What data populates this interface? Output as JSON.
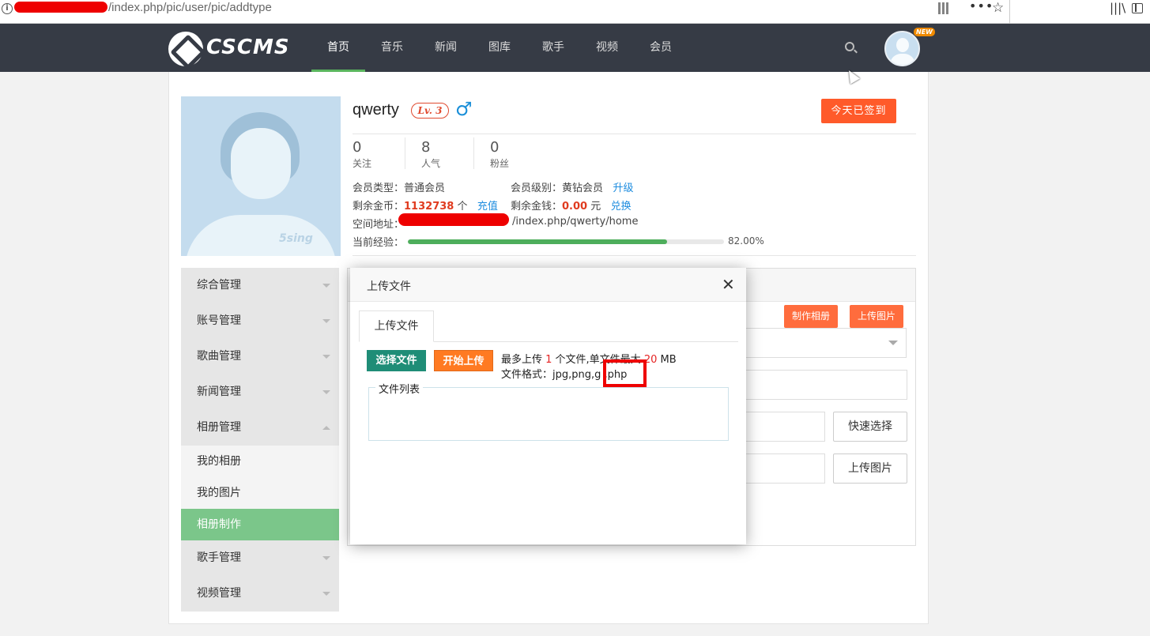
{
  "browser": {
    "url": "/index.php/pic/user/pic/addtype"
  },
  "nav": {
    "logo_text": "CSCMS",
    "items": [
      "首页",
      "音乐",
      "新闻",
      "图库",
      "歌手",
      "视频",
      "会员"
    ],
    "new_badge": "NEW"
  },
  "profile": {
    "username": "qwerty",
    "level": "Lv. 3",
    "gender_icon": "male-symbol",
    "signin_button": "今天已签到",
    "stats": [
      {
        "value": "0",
        "label": "关注"
      },
      {
        "value": "8",
        "label": "人气"
      },
      {
        "value": "0",
        "label": "粉丝"
      }
    ],
    "member_type_label": "会员类型：",
    "member_type": "普通会员",
    "member_level_label": "会员级别：",
    "member_level": "黄钻会员",
    "upgrade_link": "升级",
    "coins_label": "剩余金币：",
    "coins": "1132738",
    "coins_unit": "个",
    "recharge_link": "充值",
    "money_label": "剩余金钱：",
    "money": "0.00",
    "money_unit": "元",
    "exchange_link": "兑换",
    "space_label": "空间地址：",
    "space_url_tail": "/index.php/qwerty/home",
    "exp_label": "当前经验：",
    "exp_percent_text": "82.00%",
    "exp_fraction": 0.82,
    "avatar_brand": "5sing"
  },
  "sidebar": {
    "items": [
      "综合管理",
      "账号管理",
      "歌曲管理",
      "新闻管理",
      "相册管理"
    ],
    "sub_items": [
      "我的相册",
      "我的图片",
      "相册制作"
    ],
    "active_sub": "相册制作",
    "bottom_items": [
      "歌手管理",
      "视频管理"
    ]
  },
  "content": {
    "make_album_button": "制作相册",
    "upload_image_button": "上传图片",
    "quick_select_button": "快速选择",
    "upload_image_button_2": "上传图片"
  },
  "modal": {
    "title": "上传文件",
    "tab": "上传文件",
    "choose_button": "选择文件",
    "start_button": "开始上传",
    "limit_prefix": "最多上传 ",
    "limit_count": "1",
    "limit_middle": " 个文件,单文件最大 ",
    "limit_size": "20",
    "limit_suffix": " MB",
    "formats": "文件格式：jpg,png,g ,php",
    "filelist_legend": "文件列表"
  },
  "colors": {
    "nav_bg": "#363b45",
    "accent_orange": "#ff5a2a",
    "accent_green": "#7bc68a",
    "teal_button": "#1f8d77",
    "highlight_red": "#ee0000"
  }
}
